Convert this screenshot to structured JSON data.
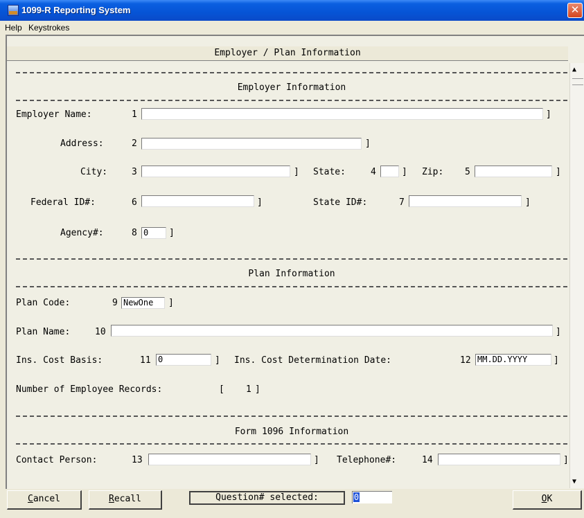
{
  "window": {
    "title": "1099-R Reporting System",
    "close_glyph": "✕"
  },
  "menu": {
    "items": [
      "Help",
      "Keystrokes"
    ]
  },
  "header": {
    "title": "Employer / Plan Information"
  },
  "employer": {
    "section_title": "Employer Information",
    "name_label": "Employer Name:",
    "name_num": "1",
    "name_value": "",
    "address_label": "Address:",
    "address_num": "2",
    "address_value": "",
    "city_label": "City:",
    "city_num": "3",
    "city_value": "",
    "state_label": "State:",
    "state_num": "4",
    "state_value": "",
    "zip_label": "Zip:",
    "zip_num": "5",
    "zip_value": "",
    "federal_label": "Federal ID#:",
    "federal_num": "6",
    "federal_value": "",
    "stateid_label": "State ID#:",
    "stateid_num": "7",
    "stateid_value": "",
    "agency_label": "Agency#:",
    "agency_num": "8",
    "agency_value": "0"
  },
  "plan": {
    "section_title": "Plan Information",
    "code_label": "Plan Code:",
    "code_num": "9",
    "code_value": "NewOne",
    "name_label": "Plan Name:",
    "name_num": "10",
    "name_value": "",
    "basis_label": "Ins. Cost Basis:",
    "basis_num": "11",
    "basis_value": "0",
    "date_label": "Ins. Cost Determination Date:",
    "date_num": "12",
    "date_value": "MM.DD.YYYY",
    "records_label": "Number of Employee Records:",
    "records_count": "1"
  },
  "form1096": {
    "section_title": "Form 1096 Information",
    "contact_label": "Contact Person:",
    "contact_num": "13",
    "contact_value": "",
    "phone_label": "Telephone#:",
    "phone_num": "14",
    "phone_value": ""
  },
  "bottom": {
    "cancel": {
      "first": "C",
      "rest": "ancel"
    },
    "recall": {
      "first": "R",
      "rest": "ecall"
    },
    "question_label": "Question# selected:",
    "question_value": "0",
    "ok": {
      "first": "O",
      "rest": "K"
    }
  },
  "icons": {
    "app": "app-logo-icon",
    "close": "close-icon",
    "scroll_up": "▲",
    "scroll_down": "▼"
  }
}
